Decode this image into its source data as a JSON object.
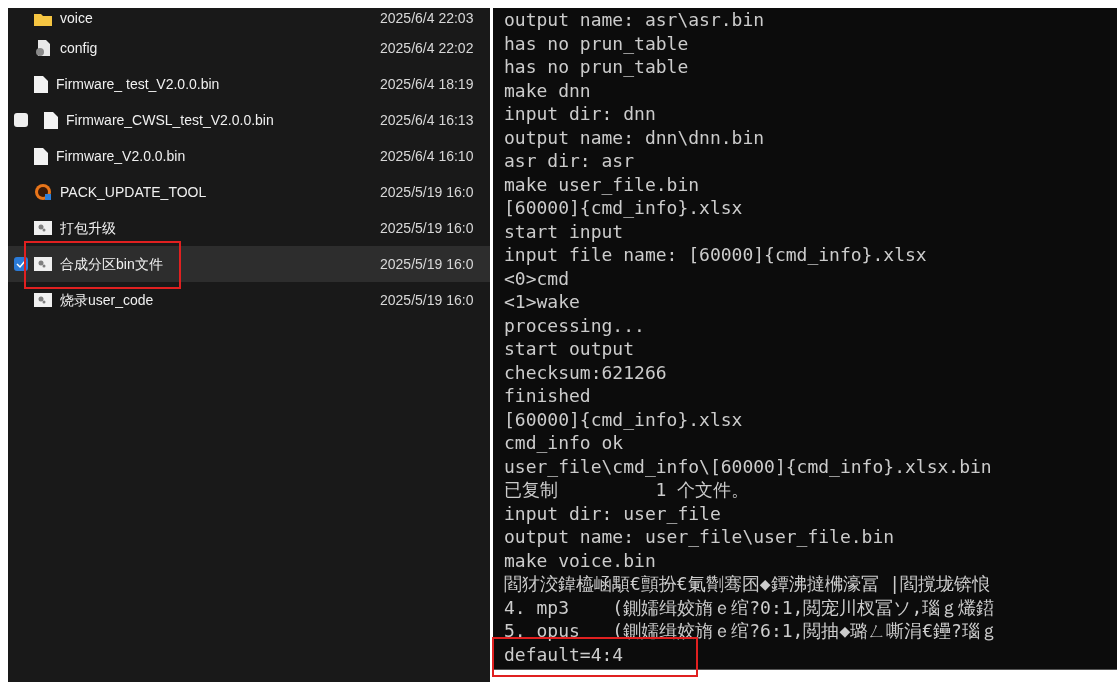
{
  "files": [
    {
      "name": "voice",
      "date": "2025/6/4 22:03",
      "kind": "folder",
      "selected": false,
      "checkbox": false
    },
    {
      "name": "config",
      "date": "2025/6/4 22:02",
      "kind": "settings",
      "selected": false,
      "checkbox": false
    },
    {
      "name": "Firmware_ test_V2.0.0.bin",
      "date": "2025/6/4 18:19",
      "kind": "file",
      "selected": false,
      "checkbox": false
    },
    {
      "name": "Firmware_CWSL_test_V2.0.0.bin",
      "date": "2025/6/4 16:13",
      "kind": "file",
      "selected": false,
      "checkbox": true
    },
    {
      "name": "Firmware_V2.0.0.bin",
      "date": "2025/6/4 16:10",
      "kind": "file",
      "selected": false,
      "checkbox": false
    },
    {
      "name": "PACK_UPDATE_TOOL",
      "date": "2025/5/19 16:0",
      "kind": "app",
      "selected": false,
      "checkbox": false
    },
    {
      "name": "打包升级",
      "date": "2025/5/19 16:0",
      "kind": "script",
      "selected": false,
      "checkbox": false
    },
    {
      "name": "合成分区bin文件",
      "date": "2025/5/19 16:0",
      "kind": "script",
      "selected": true,
      "checkbox": true
    },
    {
      "name": "烧录user_code",
      "date": "2025/5/19 16:0",
      "kind": "script",
      "selected": false,
      "checkbox": false
    }
  ],
  "terminal": {
    "lines": [
      "output name: asr\\asr.bin",
      "has no prun_table",
      "has no prun_table",
      "make dnn",
      "input dir: dnn",
      "output name: dnn\\dnn.bin",
      "asr dir: asr",
      "make user_file.bin",
      "[60000]{cmd_info}.xlsx",
      "start input",
      "input file name: [60000]{cmd_info}.xlsx",
      "<0>cmd",
      "<1>wake",
      "processing...",
      "start output",
      "checksum:621266",
      "finished",
      "[60000]{cmd_info}.xlsx",
      "cmd_info ok",
      "user_file\\cmd_info\\[60000]{cmd_info}.xlsx.bin",
      "已复制         1 个文件。",
      "input dir: user_file",
      "output name: user_file\\user_file.bin",
      "make voice.bin",
      "閻犲洨鍏橀崡顒€顫扮€氭劗骞囨◆鐔沸撻梻濠冨 |閻撹垅锛悢",
      "4. mp3    (鍘嬬缉姣旓ｅ绾?0:1,閲宠川杈冨ソ,瑙ｇ爜鍣",
      "5. opus   (鍘嬬缉姣旓ｅ绾?6:1,閲抽◆璐ㄥ嘶涓€鑸?瑙ｇ",
      "default=4:4"
    ]
  }
}
